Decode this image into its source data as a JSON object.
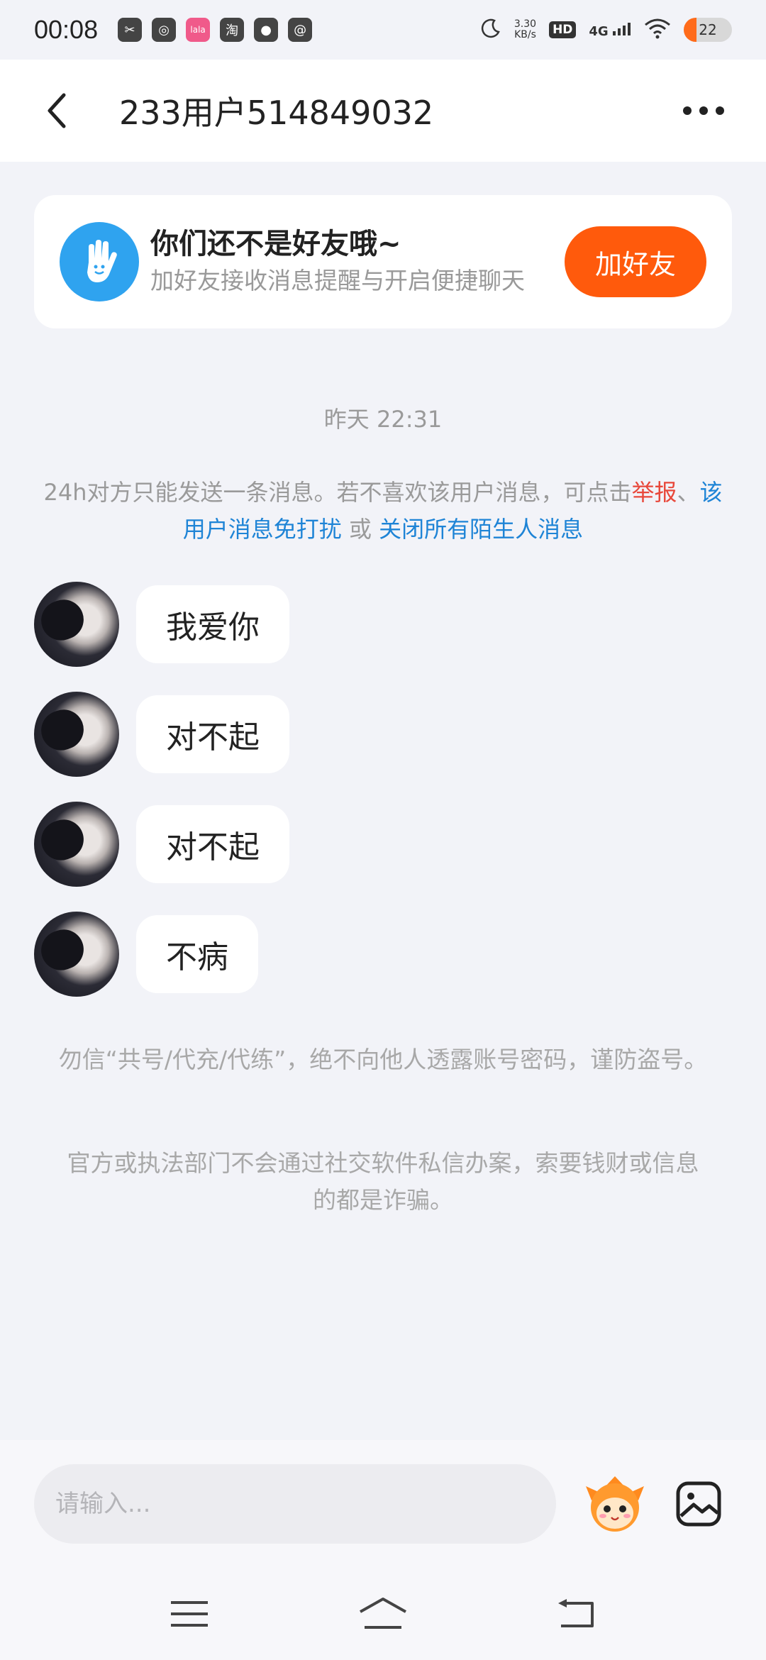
{
  "status_bar": {
    "time": "00:08",
    "app_icons": [
      "scissors-app-icon",
      "wechat-icon",
      "lala-app-icon",
      "taobao-icon",
      "messenger-icon",
      "at-app-icon"
    ],
    "app_glyphs": [
      "✂",
      "◎",
      "lala",
      "淘",
      "●",
      "@"
    ],
    "net_speed_value": "3.30",
    "net_speed_unit": "KB/s",
    "hd_label": "HD",
    "signal_label": "4G",
    "battery_level": "22"
  },
  "header": {
    "title": "233用户514849032"
  },
  "friend_prompt": {
    "title": "你们还不是好友哦~",
    "subtitle": "加好友接收消息提醒与开启便捷聊天",
    "button_label": "加好友"
  },
  "chat": {
    "timestamp": "昨天 22:31",
    "notice": {
      "text": "24h对方只能发送一条消息。若不喜欢该用户消息，可点击",
      "report_link": "举报",
      "separator": "、",
      "mute_link": "该用户消息免打扰",
      "or_text": " 或 ",
      "close_link": "关闭所有陌生人消息"
    },
    "messages": [
      {
        "text": "我爱你"
      },
      {
        "text": "对不起"
      },
      {
        "text": "对不起"
      },
      {
        "text": "不病"
      }
    ],
    "warnings": [
      "勿信“共号/代充/代练”，绝不向他人透露账号密码，谨防盗号。",
      "官方或执法部门不会通过社交软件私信办案，索要钱财或信息的都是诈骗。"
    ]
  },
  "input": {
    "placeholder": "请输入..."
  },
  "colors": {
    "accent": "#ff5a0c",
    "link_blue": "#1e84d6",
    "link_red": "#e8483b",
    "friend_icon_bg": "#2fa3ef"
  }
}
